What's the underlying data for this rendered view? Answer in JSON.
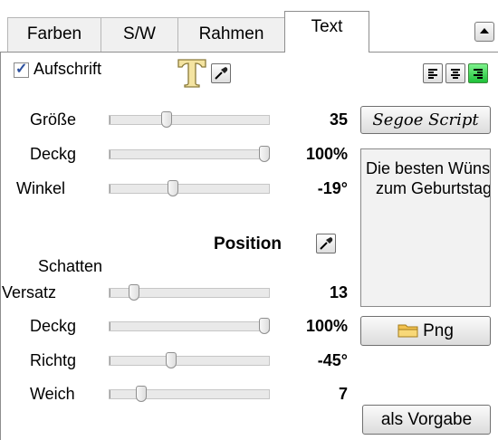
{
  "tabs": [
    {
      "label": "Farben",
      "active": false
    },
    {
      "label": "S/W",
      "active": false
    },
    {
      "label": "Rahmen",
      "active": false
    },
    {
      "label": "Text",
      "active": true
    }
  ],
  "caption": {
    "label": "Aufschrift",
    "checked": true
  },
  "alignment": [
    "left",
    "center",
    "right"
  ],
  "active_alignment": "right",
  "font_button": {
    "label": "Segoe Script"
  },
  "text_sliders": [
    {
      "label": "Größe",
      "value": "35",
      "fraction": 0.35
    },
    {
      "label": "Deckg",
      "value": "100%",
      "fraction": 1.0
    },
    {
      "label": "Winkel",
      "value": "-19°",
      "fraction": 0.39
    }
  ],
  "position_label": "Position",
  "shadow_label": "Schatten",
  "shadow_sliders": [
    {
      "label": "Versatz",
      "value": "13",
      "fraction": 0.13
    },
    {
      "label": "Deckg",
      "value": "100%",
      "fraction": 1.0
    },
    {
      "label": "Richtg",
      "value": "-45°",
      "fraction": 0.38
    },
    {
      "label": "Weich",
      "value": "7",
      "fraction": 0.18
    }
  ],
  "preview_lines": [
    "Die besten Wünsche",
    "zum Geburtstag"
  ],
  "png_button": {
    "label": "Png"
  },
  "default_button": {
    "label": "als Vorgabe"
  },
  "colors": {
    "active_align": "#2ecc40",
    "folder": "#f2c14e",
    "text_icon": "#f4e4a1"
  }
}
